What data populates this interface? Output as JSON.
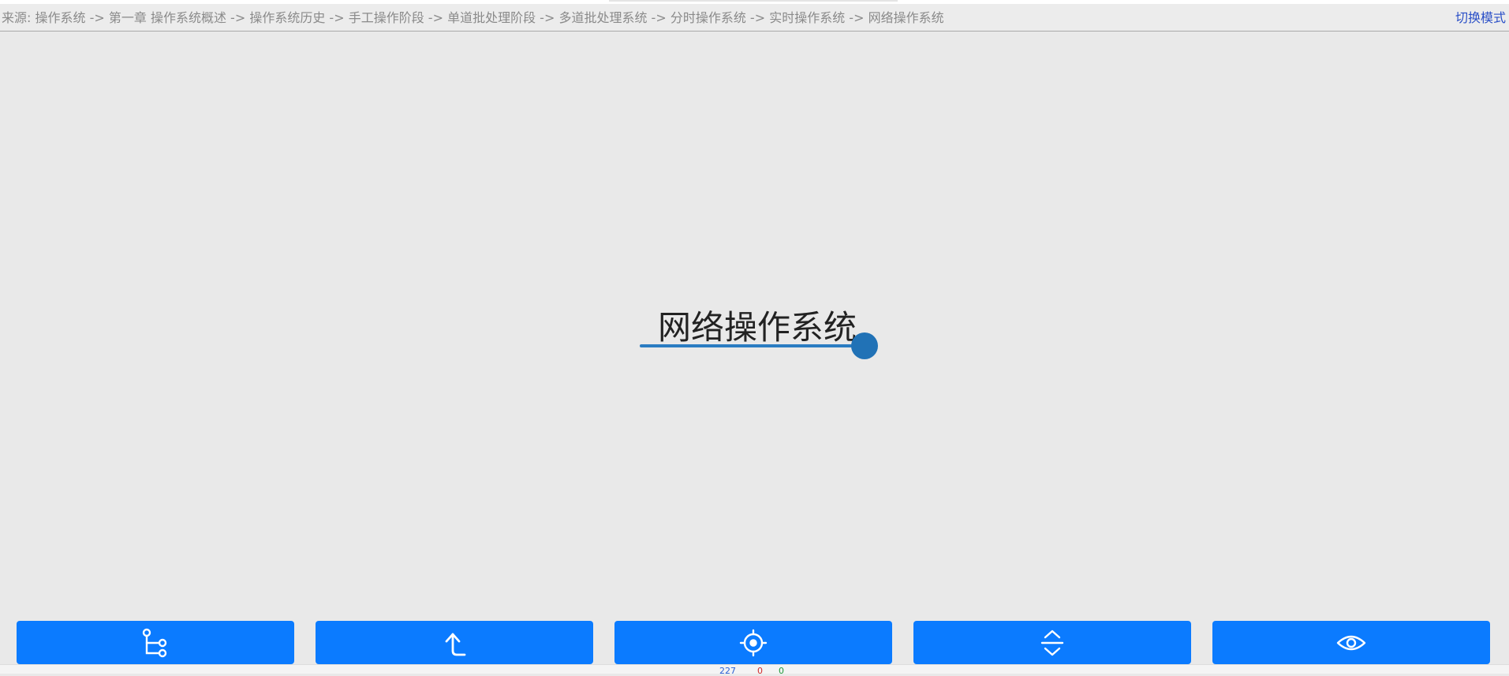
{
  "breadcrumb": {
    "prefix": "来源:",
    "items": [
      "操作系统",
      "第一章 操作系统概述",
      "操作系统历史",
      "手工操作阶段",
      "单道批处理阶段",
      "多道批处理系统",
      "分时操作系统",
      "实时操作系统",
      "网络操作系统"
    ],
    "separator": "->"
  },
  "header": {
    "switch_mode_label": "切换模式"
  },
  "node": {
    "title": "网络操作系统",
    "accent_color": "#2172b6"
  },
  "toolbar": {
    "button_color": "#0b7bff",
    "buttons": [
      {
        "icon": "tree-structure-icon"
      },
      {
        "icon": "arrow-up-back-icon"
      },
      {
        "icon": "target-locate-icon"
      },
      {
        "icon": "expand-collapse-icon"
      },
      {
        "icon": "eye-icon"
      }
    ]
  },
  "footer": {
    "counter_1": "227",
    "counter_2": "0",
    "counter_3": "0"
  }
}
